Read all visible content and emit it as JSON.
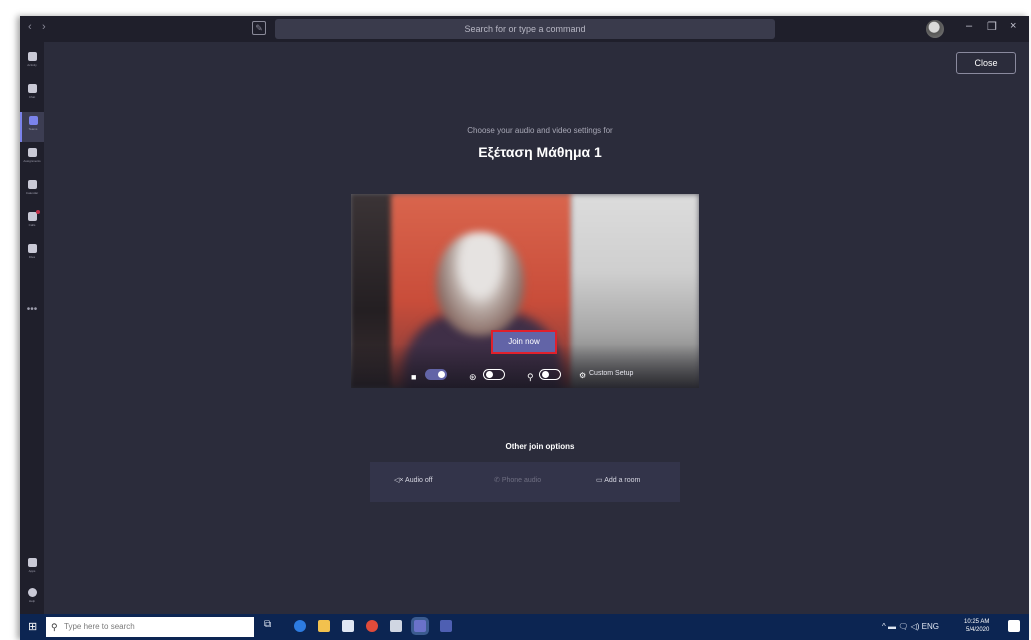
{
  "titlebar": {
    "search_placeholder": "Search for or type a command",
    "nav_back": "‹",
    "nav_forward": "›",
    "minimize": "–",
    "restore": "❐",
    "close": "×"
  },
  "rail": {
    "items": [
      {
        "label": "Activity"
      },
      {
        "label": "Chat"
      },
      {
        "label": "Teams"
      },
      {
        "label": "Assignments"
      },
      {
        "label": "Calendar"
      },
      {
        "label": "Calls"
      },
      {
        "label": "Files"
      }
    ],
    "more": "•••",
    "bottom": [
      {
        "label": "Apps"
      },
      {
        "label": "Help"
      }
    ]
  },
  "main": {
    "close_label": "Close",
    "subtitle": "Choose your audio and video settings for",
    "meeting_title": "Εξέταση Μάθημα 1",
    "join_label": "Join now",
    "custom_setup_label": "Custom Setup",
    "other_options_heading": "Other join options",
    "options": [
      {
        "label": "Audio off",
        "icon": "speaker-off-icon"
      },
      {
        "label": "Phone audio",
        "icon": "phone-icon"
      },
      {
        "label": "Add a room",
        "icon": "room-icon"
      }
    ]
  },
  "taskbar": {
    "search_placeholder": "Type here to search",
    "time": "10:25 AM",
    "date": "5/4/2020",
    "tray": "^ ▬ 🗨 ◁) ENG"
  },
  "colors": {
    "accent": "#6264a7",
    "highlight_border": "#e0202c",
    "background": "#2b2c3b",
    "taskbar": "#0c2552"
  }
}
